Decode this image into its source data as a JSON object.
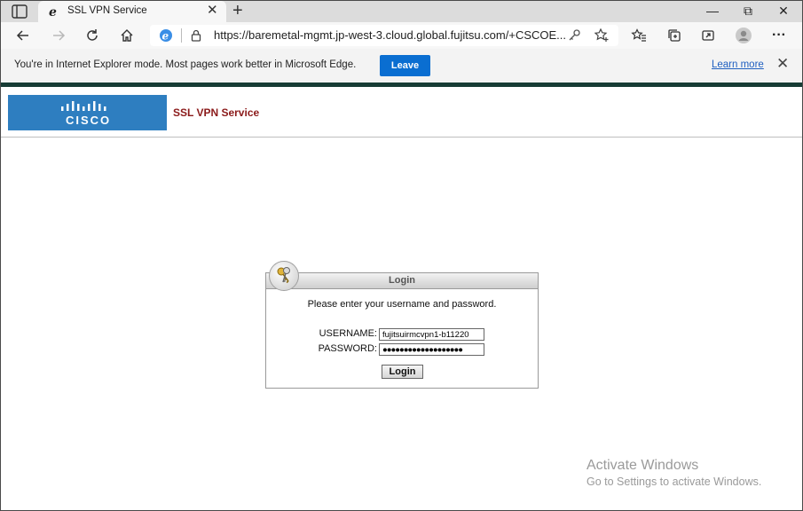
{
  "browser": {
    "tab_title": "SSL VPN Service",
    "tab_close": "✕",
    "new_tab": "+",
    "window_controls": {
      "minimize": "—",
      "restore": "⧉",
      "close": "✕"
    },
    "url": "https://baremetal-mgmt.jp-west-3.cloud.global.fujitsu.com/+CSCOE...",
    "icons": [
      "sidebar-icon",
      "ie-icon",
      "back-icon",
      "forward-icon",
      "refresh-icon",
      "home-icon",
      "lock-icon",
      "key-icon",
      "favorite-add-icon",
      "favorites-icon",
      "collections-icon",
      "share-icon",
      "profile-icon",
      "more-icon"
    ],
    "more": "···"
  },
  "ie_mode_bar": {
    "message": "You're in Internet Explorer mode. Most pages work better in Microsoft Edge.",
    "leave_label": "Leave",
    "learn_more": "Learn more",
    "close": "✕",
    "accent_color": "#0a6ed1"
  },
  "page": {
    "logo_text": "CISCO",
    "service_title": "SSL VPN Service",
    "title_color": "#8b1a1a",
    "logo_color": "#2e7ec0"
  },
  "login": {
    "title": "Login",
    "message": "Please enter your username and password.",
    "username_label": "USERNAME:",
    "username_value": "fujitsuirmcvpn1-b11220",
    "password_label": "PASSWORD:",
    "password_value": "●●●●●●●●●●●●●●●●●●●",
    "button_label": "Login"
  },
  "watermark": {
    "title": "Activate Windows",
    "subtitle": "Go to Settings to activate Windows."
  }
}
